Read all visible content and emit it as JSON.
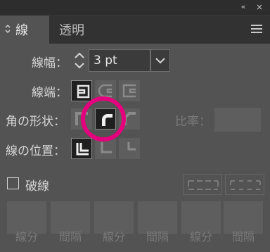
{
  "titlebar": {
    "collapse_glyph": "‹‹",
    "close_glyph": "×"
  },
  "tabs": [
    {
      "label": "線"
    },
    {
      "label": "透明"
    }
  ],
  "stroke": {
    "weight_label": "線幅：",
    "weight_value": "3 pt",
    "cap_label": "線端：",
    "join_label": "角の形状：",
    "limit_label": "比率：",
    "align_label": "線の位置：",
    "dashed_label": "破線",
    "dash_labels": [
      "線分",
      "間隔",
      "線分",
      "間隔",
      "線分",
      "間隔"
    ]
  },
  "accent": "#e5007d"
}
